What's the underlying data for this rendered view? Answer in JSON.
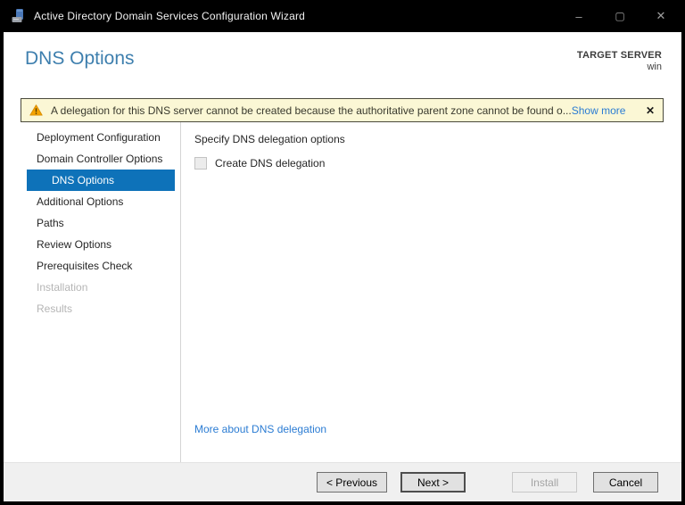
{
  "window": {
    "title": "Active Directory Domain Services Configuration Wizard",
    "controls": {
      "minimize": "–",
      "maximize": "▢",
      "close": "✕"
    }
  },
  "header": {
    "page_title": "DNS Options",
    "target_server_label": "TARGET SERVER",
    "target_server_value": "win"
  },
  "banner": {
    "message": "A delegation for this DNS server cannot be created because the authoritative parent zone cannot be found o...",
    "show_more_label": "Show more",
    "close_label": "✕"
  },
  "sidebar": {
    "items": [
      {
        "label": "Deployment Configuration",
        "state": "normal"
      },
      {
        "label": "Domain Controller Options",
        "state": "normal"
      },
      {
        "label": "DNS Options",
        "state": "selected"
      },
      {
        "label": "Additional Options",
        "state": "normal"
      },
      {
        "label": "Paths",
        "state": "normal"
      },
      {
        "label": "Review Options",
        "state": "normal"
      },
      {
        "label": "Prerequisites Check",
        "state": "normal"
      },
      {
        "label": "Installation",
        "state": "disabled"
      },
      {
        "label": "Results",
        "state": "disabled"
      }
    ]
  },
  "content": {
    "instruction": "Specify DNS delegation options",
    "checkbox_label": "Create DNS delegation",
    "checkbox_checked": false,
    "checkbox_enabled": false,
    "link": "More about DNS delegation"
  },
  "footer": {
    "buttons": [
      {
        "label": "< Previous",
        "state": "normal"
      },
      {
        "label": "Next >",
        "state": "default"
      },
      {
        "label": "Install",
        "state": "disabled"
      },
      {
        "label": "Cancel",
        "state": "normal"
      }
    ]
  },
  "colors": {
    "titlebar_bg": "#000000",
    "heading_blue": "#3e7fae",
    "selected_nav_blue": "#0e72b9",
    "link_blue": "#2b7cd3",
    "banner_bg": "#fbf7d5",
    "banner_border": "#4a4a3c",
    "warning_orange": "#f5a300",
    "footer_bg": "#f0f0f0",
    "button_bg": "#e1e1e1"
  }
}
